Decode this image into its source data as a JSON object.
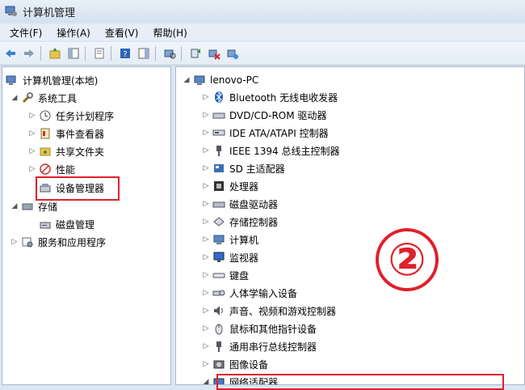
{
  "window": {
    "title": "计算机管理"
  },
  "menu": [
    "文件(F)",
    "操作(A)",
    "查看(V)",
    "帮助(H)"
  ],
  "left_tree": {
    "root": "计算机管理(本地)",
    "system_tools": "系统工具",
    "task_scheduler": "任务计划程序",
    "event_viewer": "事件查看器",
    "shared_folders": "共享文件夹",
    "performance": "性能",
    "device_manager": "设备管理器",
    "storage": "存储",
    "disk_management": "磁盘管理",
    "services_apps": "服务和应用程序"
  },
  "right_tree": {
    "root": "lenovo-PC",
    "items": [
      "Bluetooth 无线电收发器",
      "DVD/CD-ROM 驱动器",
      "IDE ATA/ATAPI 控制器",
      "IEEE 1394 总线主控制器",
      "SD 主适配器",
      "处理器",
      "磁盘驱动器",
      "存储控制器",
      "计算机",
      "监视器",
      "键盘",
      "人体学输入设备",
      "声音、视频和游戏控制器",
      "鼠标和其他指针设备",
      "通用串行总线控制器",
      "图像设备",
      "网络适配器"
    ]
  },
  "annotation": {
    "step_number": "②"
  },
  "colors": {
    "highlight": "#e0202a",
    "panel_border": "#a9b8cb"
  }
}
